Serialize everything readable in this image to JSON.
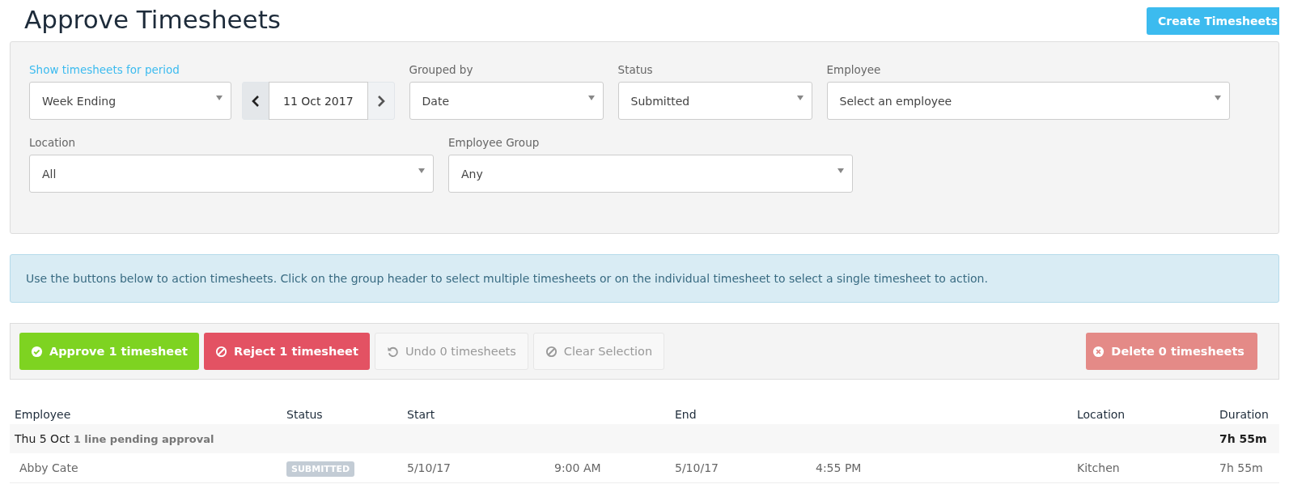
{
  "page_title": "Approve Timesheets",
  "create_button": "Create Timesheets",
  "filters": {
    "period": {
      "label": "Show timesheets for period",
      "value": "Week Ending",
      "date": "11 Oct 2017"
    },
    "row1": [
      {
        "label": "Grouped by",
        "value": "Date"
      },
      {
        "label": "Status",
        "value": "Submitted"
      },
      {
        "label": "Employee",
        "placeholder": "Select an employee"
      }
    ],
    "row2": [
      {
        "label": "Location",
        "value": "All"
      },
      {
        "label": "Employee Group",
        "value": "Any"
      }
    ]
  },
  "info": "Use the buttons below to action timesheets. Click on the group header to select multiple timesheets or on the individual timesheet to select a single timesheet to action.",
  "actions": [
    {
      "kind": "approve",
      "label": "Approve 1 timesheet",
      "disabled": false
    },
    {
      "kind": "reject",
      "label": "Reject 1 timesheet",
      "disabled": false
    },
    {
      "kind": "undo",
      "label": "Undo 0 timesheets",
      "disabled": true
    },
    {
      "kind": "clear",
      "label": "Clear Selection",
      "disabled": true
    },
    {
      "kind": "delete",
      "label": "Delete 0 timesheets",
      "disabled": true
    }
  ],
  "table": {
    "columns": [
      "Employee",
      "Status",
      "Start",
      "End",
      "Location",
      "Duration"
    ],
    "groups": [
      {
        "title": "Thu 5 Oct",
        "note": "1 line pending approval",
        "duration": "7h 55m",
        "rows": [
          {
            "employee": "Abby Cate",
            "status": "SUBMITTED",
            "start_date": "5/10/17",
            "start_time": "9:00 AM",
            "end_date": "5/10/17",
            "end_time": "4:55 PM",
            "location": "Kitchen",
            "duration": "7h 55m"
          }
        ]
      }
    ]
  }
}
